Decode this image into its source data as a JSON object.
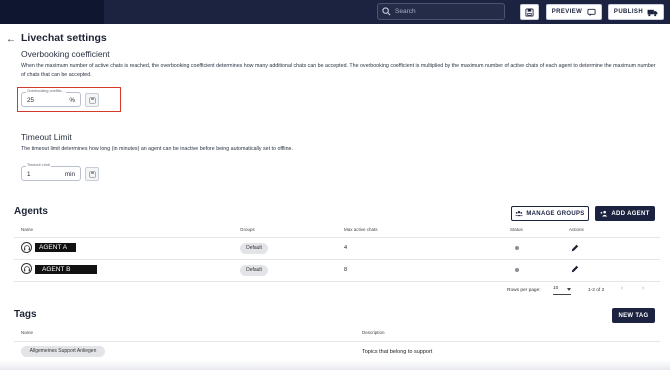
{
  "topbar": {
    "search_placeholder": "Search",
    "preview_label": "PREVIEW",
    "publish_label": "PUBLISH"
  },
  "page": {
    "title": "Livechat settings"
  },
  "overbooking": {
    "heading": "Overbooking coefficient",
    "description": "When the maximum number of active chats is reached, the overbooking coefficient determines how many additional chats can be accepted. The overbooking coefficient is multiplied by the maximum number of active chats of each agent to determine the maximum number of chats that can be accepted.",
    "field_label": "Overbooking coeffici...",
    "field_value": "25",
    "field_unit": "%"
  },
  "timeout": {
    "heading": "Timeout Limit",
    "description": "The timeout limit determines how long (in minutes) an agent can be inactive before being automatically set to offline.",
    "field_label": "Timeout Limit",
    "field_value": "1",
    "field_unit": "min"
  },
  "agents": {
    "heading": "Agents",
    "manage_groups_label": "MANAGE GROUPS",
    "add_agent_label": "ADD AGENT",
    "columns": [
      "Name",
      "Groups",
      "Max active chats",
      "Status",
      "Actions"
    ],
    "rows": [
      {
        "name": "AGENT A",
        "group": "Default",
        "max_chats": "4"
      },
      {
        "name": "AGENT B",
        "group": "Default",
        "max_chats": "8"
      }
    ],
    "pagination": {
      "rows_per_page_label": "Rows per page:",
      "rows_per_page_value": "10",
      "range": "1-2 of 2"
    }
  },
  "tags": {
    "heading": "Tags",
    "new_tag_label": "NEW TAG",
    "columns": [
      "Name",
      "Description"
    ],
    "rows": [
      {
        "name": "Allgemeines Support Anliegen",
        "description": "Topics that belong to support"
      }
    ]
  },
  "colors": {
    "navy": "#1b2340",
    "highlight": "#d43a2c"
  }
}
